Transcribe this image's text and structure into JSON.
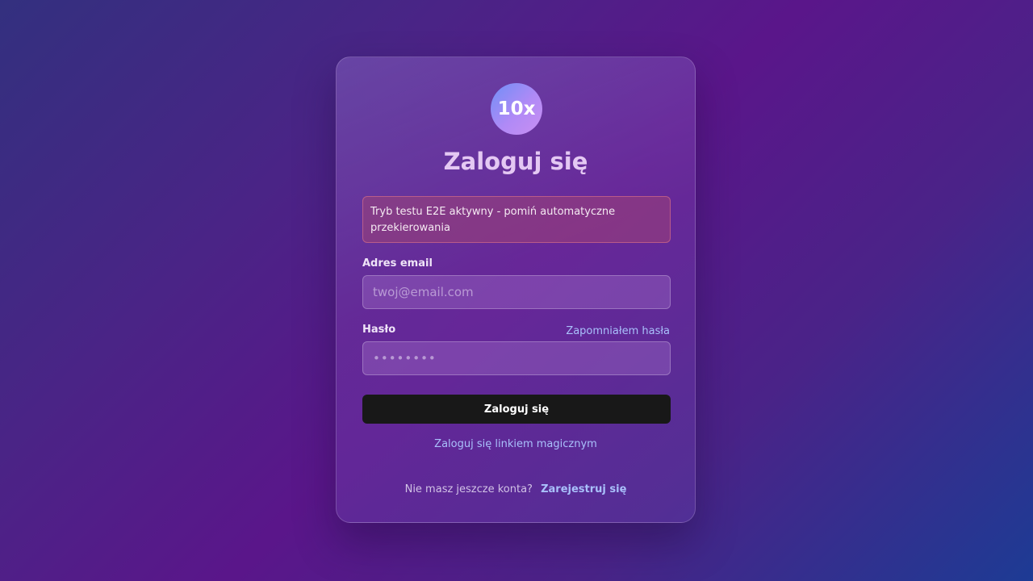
{
  "logo": {
    "text": "10x"
  },
  "title": "Zaloguj się",
  "alert": {
    "message": "Tryb testu E2E aktywny - pomiń automatyczne przekierowania"
  },
  "email": {
    "label": "Adres email",
    "placeholder": "twoj@email.com",
    "value": ""
  },
  "password": {
    "label": "Hasło",
    "placeholder": "••••••••",
    "value": "",
    "forgot_label": "Zapomniałem hasła"
  },
  "submit_label": "Zaloguj się",
  "magic_link_label": "Zaloguj się linkiem magicznym",
  "signup": {
    "prompt": "Nie masz jeszcze konta?",
    "link_label": "Zarejestruj się"
  },
  "colors": {
    "primary_button": "#181818",
    "link": "#a9c0fb",
    "title": "#e4c8f3"
  }
}
